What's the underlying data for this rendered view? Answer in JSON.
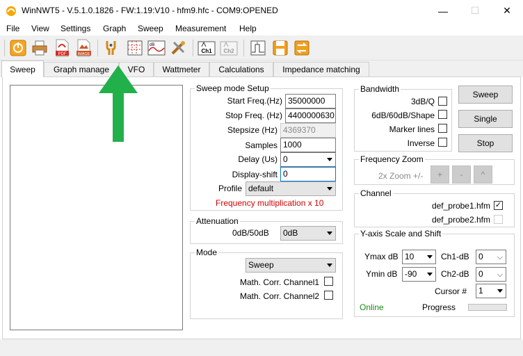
{
  "window": {
    "title": "WinNWT5 - V.5.1.0.1826 - FW:1.19:V10 - hfm9.hfc - COM9:OPENED",
    "min_glyph": "—",
    "max_glyph": "☐",
    "close_glyph": "✕"
  },
  "menu": [
    "File",
    "View",
    "Settings",
    "Graph",
    "Sweep",
    "Measurement",
    "Help"
  ],
  "toolbar": {
    "icons": [
      "power-icon",
      "printer-icon",
      "pdf-icon",
      "image-icon",
      "probe-settings-icon",
      "grid-icon",
      "db-graph-icon",
      "calibrate-icon",
      "ch1-icon",
      "ch2-icon",
      "sweep-graph-icon",
      "save-icon",
      "swap-icon"
    ],
    "pdf_text": "PDF",
    "image_text": "IMAGE",
    "db_text": "dB",
    "ch1_text": "Ch1",
    "ch2_text": "Ch2"
  },
  "tabs": [
    "Sweep",
    "Graph manage",
    "VFO",
    "Wattmeter",
    "Calculations",
    "Impedance matching"
  ],
  "sweep_setup": {
    "title": "Sweep mode Setup",
    "start_label": "Start Freq.(Hz)",
    "start_value": "35000000",
    "stop_label": "Stop Freq. (Hz)",
    "stop_value": "4400000630",
    "step_label": "Stepsize (Hz)",
    "step_value": "4369370",
    "samples_label": "Samples",
    "samples_value": "1000",
    "delay_label": "Delay (Us)",
    "delay_value": "0",
    "shift_label": "Display-shift",
    "shift_value": "0",
    "profile_label": "Profile",
    "profile_value": "default",
    "multiplication_note": "Frequency multiplication x 10",
    "note_color": "#d40000"
  },
  "attenuation": {
    "title": "Attenuation",
    "label": "0dB/50dB",
    "value": "0dB"
  },
  "mode": {
    "title": "Mode",
    "value": "Sweep",
    "corr1_label": "Math. Corr. Channel1",
    "corr2_label": "Math. Corr. Channel2"
  },
  "bandwidth": {
    "title": "Bandwidth",
    "items": [
      {
        "label": "3dB/Q",
        "checked": false
      },
      {
        "label": "6dB/60dB/Shape",
        "checked": false
      },
      {
        "label": "Marker lines",
        "checked": false
      },
      {
        "label": "Inverse",
        "checked": false
      }
    ]
  },
  "buttons": {
    "sweep": "Sweep",
    "single": "Single",
    "stop": "Stop"
  },
  "zoom": {
    "title": "Frequency Zoom",
    "label": "2x Zoom +/-",
    "plus": "+",
    "minus": "-",
    "up": "^"
  },
  "channel": {
    "title": "Channel",
    "probe1": "def_probe1.hfm",
    "probe1_checked": true,
    "probe2": "def_probe2.hfm",
    "probe2_checked": false
  },
  "yaxis": {
    "title": "Y-axis Scale and Shift",
    "ymax_label": "Ymax dB",
    "ymax_value": "10",
    "ymin_label": "Ymin dB",
    "ymin_value": "-90",
    "ch1_label": "Ch1-dB",
    "ch1_value": "0",
    "ch2_label": "Ch2-dB",
    "ch2_value": "0",
    "cursor_label": "Cursor #",
    "cursor_value": "1",
    "online": "Online",
    "online_color": "#1a8a1a",
    "progress_label": "Progress",
    "progress_fraction": 0
  },
  "colors": {
    "accent_arrow": "#22b04a",
    "focus_border": "#0078d7"
  }
}
